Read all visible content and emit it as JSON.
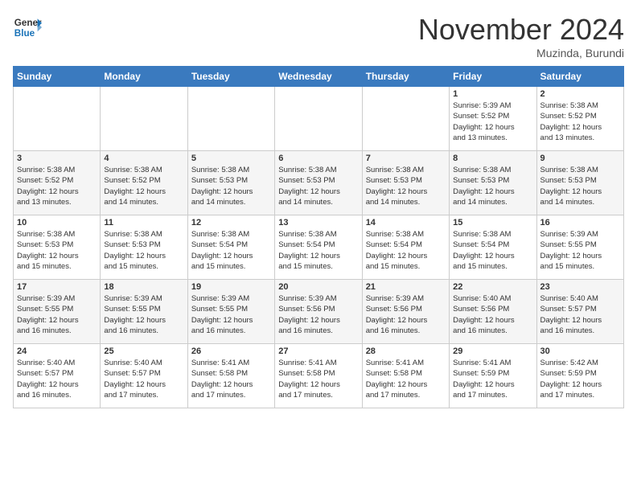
{
  "logo": {
    "line1": "General",
    "line2": "Blue"
  },
  "title": "November 2024",
  "location": "Muzinda, Burundi",
  "days_of_week": [
    "Sunday",
    "Monday",
    "Tuesday",
    "Wednesday",
    "Thursday",
    "Friday",
    "Saturday"
  ],
  "weeks": [
    [
      {
        "day": "",
        "info": ""
      },
      {
        "day": "",
        "info": ""
      },
      {
        "day": "",
        "info": ""
      },
      {
        "day": "",
        "info": ""
      },
      {
        "day": "",
        "info": ""
      },
      {
        "day": "1",
        "info": "Sunrise: 5:39 AM\nSunset: 5:52 PM\nDaylight: 12 hours\nand 13 minutes."
      },
      {
        "day": "2",
        "info": "Sunrise: 5:38 AM\nSunset: 5:52 PM\nDaylight: 12 hours\nand 13 minutes."
      }
    ],
    [
      {
        "day": "3",
        "info": "Sunrise: 5:38 AM\nSunset: 5:52 PM\nDaylight: 12 hours\nand 13 minutes."
      },
      {
        "day": "4",
        "info": "Sunrise: 5:38 AM\nSunset: 5:52 PM\nDaylight: 12 hours\nand 14 minutes."
      },
      {
        "day": "5",
        "info": "Sunrise: 5:38 AM\nSunset: 5:53 PM\nDaylight: 12 hours\nand 14 minutes."
      },
      {
        "day": "6",
        "info": "Sunrise: 5:38 AM\nSunset: 5:53 PM\nDaylight: 12 hours\nand 14 minutes."
      },
      {
        "day": "7",
        "info": "Sunrise: 5:38 AM\nSunset: 5:53 PM\nDaylight: 12 hours\nand 14 minutes."
      },
      {
        "day": "8",
        "info": "Sunrise: 5:38 AM\nSunset: 5:53 PM\nDaylight: 12 hours\nand 14 minutes."
      },
      {
        "day": "9",
        "info": "Sunrise: 5:38 AM\nSunset: 5:53 PM\nDaylight: 12 hours\nand 14 minutes."
      }
    ],
    [
      {
        "day": "10",
        "info": "Sunrise: 5:38 AM\nSunset: 5:53 PM\nDaylight: 12 hours\nand 15 minutes."
      },
      {
        "day": "11",
        "info": "Sunrise: 5:38 AM\nSunset: 5:53 PM\nDaylight: 12 hours\nand 15 minutes."
      },
      {
        "day": "12",
        "info": "Sunrise: 5:38 AM\nSunset: 5:54 PM\nDaylight: 12 hours\nand 15 minutes."
      },
      {
        "day": "13",
        "info": "Sunrise: 5:38 AM\nSunset: 5:54 PM\nDaylight: 12 hours\nand 15 minutes."
      },
      {
        "day": "14",
        "info": "Sunrise: 5:38 AM\nSunset: 5:54 PM\nDaylight: 12 hours\nand 15 minutes."
      },
      {
        "day": "15",
        "info": "Sunrise: 5:38 AM\nSunset: 5:54 PM\nDaylight: 12 hours\nand 15 minutes."
      },
      {
        "day": "16",
        "info": "Sunrise: 5:39 AM\nSunset: 5:55 PM\nDaylight: 12 hours\nand 15 minutes."
      }
    ],
    [
      {
        "day": "17",
        "info": "Sunrise: 5:39 AM\nSunset: 5:55 PM\nDaylight: 12 hours\nand 16 minutes."
      },
      {
        "day": "18",
        "info": "Sunrise: 5:39 AM\nSunset: 5:55 PM\nDaylight: 12 hours\nand 16 minutes."
      },
      {
        "day": "19",
        "info": "Sunrise: 5:39 AM\nSunset: 5:55 PM\nDaylight: 12 hours\nand 16 minutes."
      },
      {
        "day": "20",
        "info": "Sunrise: 5:39 AM\nSunset: 5:56 PM\nDaylight: 12 hours\nand 16 minutes."
      },
      {
        "day": "21",
        "info": "Sunrise: 5:39 AM\nSunset: 5:56 PM\nDaylight: 12 hours\nand 16 minutes."
      },
      {
        "day": "22",
        "info": "Sunrise: 5:40 AM\nSunset: 5:56 PM\nDaylight: 12 hours\nand 16 minutes."
      },
      {
        "day": "23",
        "info": "Sunrise: 5:40 AM\nSunset: 5:57 PM\nDaylight: 12 hours\nand 16 minutes."
      }
    ],
    [
      {
        "day": "24",
        "info": "Sunrise: 5:40 AM\nSunset: 5:57 PM\nDaylight: 12 hours\nand 16 minutes."
      },
      {
        "day": "25",
        "info": "Sunrise: 5:40 AM\nSunset: 5:57 PM\nDaylight: 12 hours\nand 17 minutes."
      },
      {
        "day": "26",
        "info": "Sunrise: 5:41 AM\nSunset: 5:58 PM\nDaylight: 12 hours\nand 17 minutes."
      },
      {
        "day": "27",
        "info": "Sunrise: 5:41 AM\nSunset: 5:58 PM\nDaylight: 12 hours\nand 17 minutes."
      },
      {
        "day": "28",
        "info": "Sunrise: 5:41 AM\nSunset: 5:58 PM\nDaylight: 12 hours\nand 17 minutes."
      },
      {
        "day": "29",
        "info": "Sunrise: 5:41 AM\nSunset: 5:59 PM\nDaylight: 12 hours\nand 17 minutes."
      },
      {
        "day": "30",
        "info": "Sunrise: 5:42 AM\nSunset: 5:59 PM\nDaylight: 12 hours\nand 17 minutes."
      }
    ]
  ]
}
